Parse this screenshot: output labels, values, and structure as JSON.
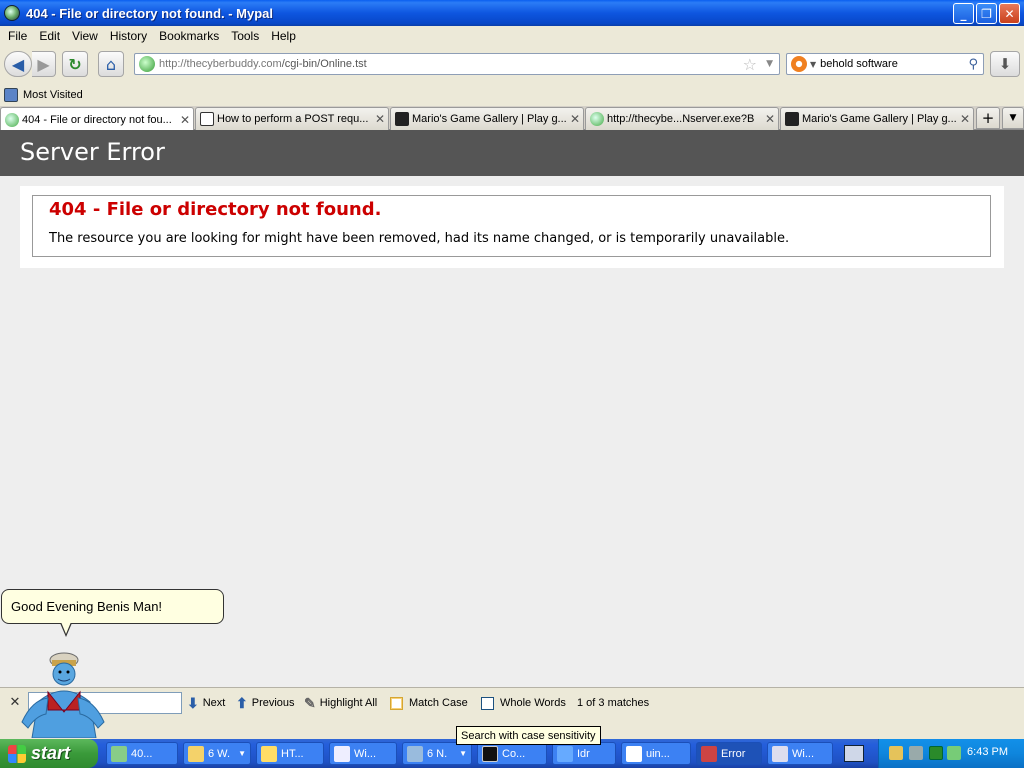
{
  "window": {
    "title": "404 - File or directory not found. - Mypal",
    "minimize": "_",
    "maximize": "❐",
    "close": "✕"
  },
  "menu": [
    "File",
    "Edit",
    "View",
    "History",
    "Bookmarks",
    "Tools",
    "Help"
  ],
  "navbar": {
    "url_host": "http://thecyberbuddy.com",
    "url_path": "/cgi-bin/Online.tst",
    "search_value": "behold software",
    "icons": [
      "back-icon",
      "forward-icon",
      "reload-icon",
      "home-icon",
      "star-icon",
      "search-icon",
      "download-icon"
    ]
  },
  "bookmarks": {
    "most_visited": "Most Visited"
  },
  "tabs": [
    {
      "label": "404 - File or directory not fou...",
      "favicon": "genie",
      "active": true
    },
    {
      "label": "How to perform a POST requ...",
      "favicon": "terminal",
      "active": false
    },
    {
      "label": "Mario's Game Gallery | Play g...",
      "favicon": "dark",
      "active": false
    },
    {
      "label": "http://thecybe...Nserver.exe?B",
      "favicon": "genie",
      "active": false
    },
    {
      "label": "Mario's Game Gallery | Play g...",
      "favicon": "dark",
      "active": false
    }
  ],
  "tab_close": "✕",
  "new_tab": "+",
  "page": {
    "header": "Server Error",
    "error_title": "404 - File or directory not found.",
    "error_message": "The resource you are looking for might have been removed, had its name changed, or is temporarily unavailable.",
    "header_bg": "#555555",
    "error_color": "#cc0000"
  },
  "agent": {
    "speech": "Good Evening Benis Man!"
  },
  "findbar": {
    "close": "✕",
    "query": "",
    "next": "Next",
    "previous": "Previous",
    "highlight_all": "Highlight All",
    "match_case": "Match Case",
    "whole_words": "Whole Words",
    "status": "1 of 3 matches",
    "tooltip": "Search with case sensitivity"
  },
  "taskbar": {
    "start": "start",
    "tasks": [
      {
        "label": "40...",
        "group": false
      },
      {
        "label": "6 W.",
        "group": true
      },
      {
        "label": "HT...",
        "group": false
      },
      {
        "label": "Wi...",
        "group": false
      },
      {
        "label": "6 N.",
        "group": true
      },
      {
        "label": "Co...",
        "group": false
      },
      {
        "label": "Idr",
        "group": false
      },
      {
        "label": "uin...",
        "group": false
      },
      {
        "label": "Error",
        "group": false
      },
      {
        "label": "Wi...",
        "group": false
      }
    ],
    "clock": "6:43 PM"
  }
}
